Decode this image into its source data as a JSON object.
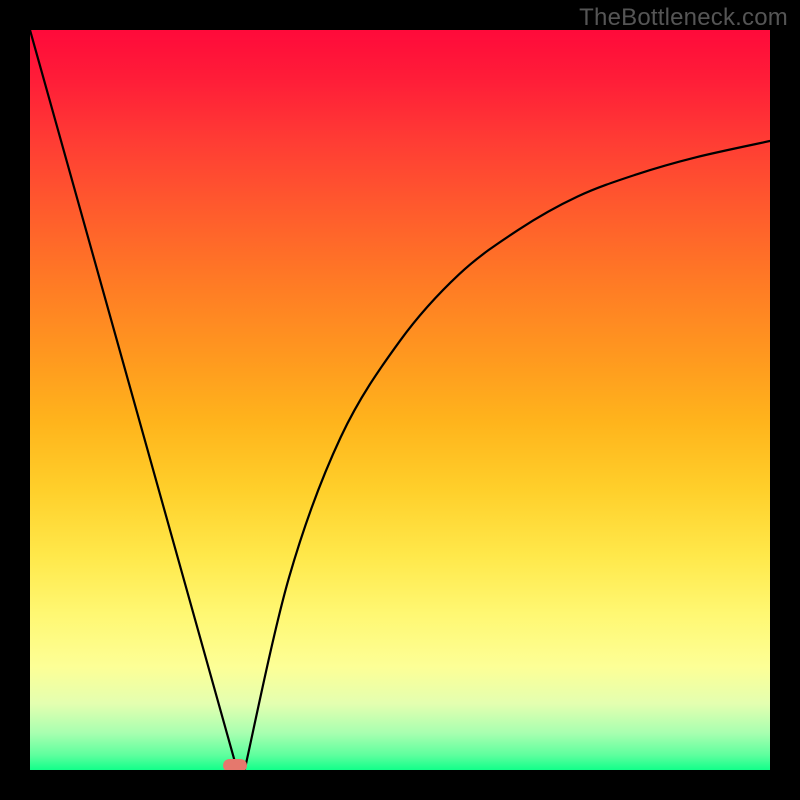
{
  "watermark": "TheBottleneck.com",
  "chart_data": {
    "type": "line",
    "title": "",
    "xlabel": "",
    "ylabel": "",
    "xlim": [
      0,
      100
    ],
    "ylim": [
      0,
      100
    ],
    "grid": false,
    "legend": false,
    "series": [
      {
        "name": "left-branch",
        "x": [
          0,
          28
        ],
        "values": [
          100,
          0
        ]
      },
      {
        "name": "right-branch",
        "x": [
          29,
          35,
          42,
          50,
          58,
          66,
          74,
          82,
          90,
          100
        ],
        "values": [
          0,
          26,
          45,
          58,
          67,
          73,
          77.5,
          80.5,
          82.8,
          85
        ]
      }
    ],
    "gradient_colors": {
      "top": "#ff0a3a",
      "mid": "#ffcf2a",
      "bottom": "#12ff8a"
    },
    "marker": {
      "x_norm": 0.277,
      "y_norm": 0.993,
      "color": "#e5786d"
    }
  }
}
